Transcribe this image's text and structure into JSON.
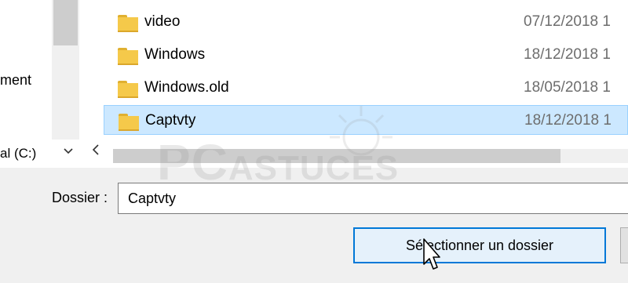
{
  "nav": {
    "partial_item": "ment",
    "drive_label": "al (C:)"
  },
  "files": [
    {
      "name": "video",
      "date": "07/12/2018 1",
      "selected": false
    },
    {
      "name": "Windows",
      "date": "18/12/2018 1",
      "selected": false
    },
    {
      "name": "Windows.old",
      "date": "18/05/2018 1",
      "selected": false
    },
    {
      "name": "Captvty",
      "date": "18/12/2018 1",
      "selected": true
    }
  ],
  "footer": {
    "folder_label": "Dossier :",
    "folder_value": "Captvty",
    "select_button_label": "Sélectionner un dossier"
  },
  "watermark": {
    "text_big": "PC",
    "text_small": "ASTUCES"
  },
  "colors": {
    "selection_bg": "#cce8ff",
    "selection_border": "#99d1ff",
    "folder_yellow": "#f5c94a",
    "button_focus": "#0078d7",
    "dialog_bg": "#f0f0f0"
  },
  "icons": {
    "folder": "folder-icon",
    "drive_chevron": "chevron-down-icon",
    "scroll_left": "chevron-left-icon",
    "cursor": "mouse-pointer-icon"
  }
}
